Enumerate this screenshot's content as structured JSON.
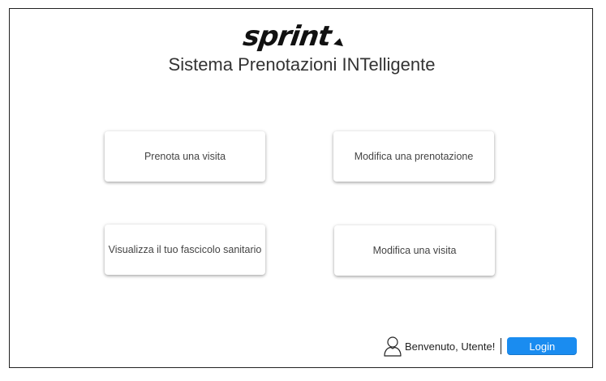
{
  "header": {
    "logo_text": "sprint",
    "subtitle": "Sistema Prenotazioni INTelligente"
  },
  "menu": {
    "items": [
      {
        "label": "Prenota una visita"
      },
      {
        "label": "Modifica una prenotazione"
      },
      {
        "label": "Visualizza il tuo fascicolo sanitario"
      },
      {
        "label": "Modifica una visita"
      }
    ]
  },
  "footer": {
    "user_icon": "user-icon",
    "welcome_text": "Benvenuto, Utente!",
    "login_label": "Login"
  },
  "colors": {
    "accent": "#1a8cf0",
    "text": "#333333",
    "border": "#222222"
  }
}
